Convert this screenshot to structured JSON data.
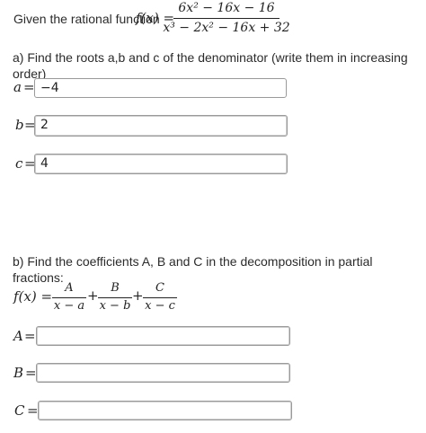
{
  "intro": {
    "text": "Given the rational function",
    "fx": "f(x) =",
    "numerator": "6x² − 16x − 16",
    "denominator": "x³ − 2x² − 16x + 32"
  },
  "part_a": {
    "prompt": "a) Find the roots a,b and c of the denominator (write them in increasing order)",
    "rows": [
      {
        "var": "a",
        "value": "−4"
      },
      {
        "var": "b",
        "value": "2"
      },
      {
        "var": "c",
        "value": "4"
      }
    ]
  },
  "part_b": {
    "prompt": "b) Find the coefficients A, B and C in the decomposition in partial fractions:",
    "fx": "f(x) =",
    "terms": [
      {
        "num": "A",
        "den": "x − a"
      },
      {
        "num": "B",
        "den": "x − b"
      },
      {
        "num": "C",
        "den": "x − c"
      }
    ],
    "rows": [
      {
        "var": "A",
        "value": ""
      },
      {
        "var": "B",
        "value": ""
      },
      {
        "var": "C",
        "value": ""
      }
    ]
  },
  "symbols": {
    "equals": "=",
    "plus": "+"
  }
}
